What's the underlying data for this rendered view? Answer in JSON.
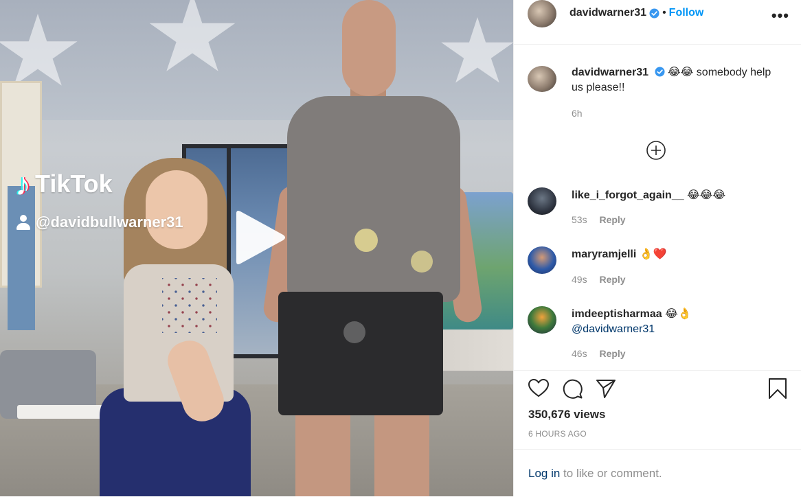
{
  "video": {
    "overlay_brand": "TikTok",
    "overlay_handle": "@davidbullwarner31"
  },
  "post": {
    "author": "davidwarner31",
    "follow_label": "Follow",
    "separator": "•",
    "caption": "😂😂 somebody help us please!!",
    "caption_time": "6h"
  },
  "comments": [
    {
      "user": "like_i_forgot_again__",
      "text": "😂😂😂",
      "time": "53s",
      "reply": "Reply"
    },
    {
      "user": "maryramjelli",
      "text": "👌❤️",
      "time": "49s",
      "reply": "Reply"
    },
    {
      "user": "imdeeptisharmaa",
      "text": "😂👌",
      "mention": "@davidwarner31",
      "time": "46s",
      "reply": "Reply"
    }
  ],
  "stats": {
    "views": "350,676 views",
    "posted": "6 HOURS AGO"
  },
  "footer": {
    "login_link": "Log in",
    "login_rest": " to like or comment."
  },
  "colors": {
    "link_blue": "#0095f6",
    "mention_blue": "#00376b",
    "muted": "#8e8e8e"
  },
  "icons": [
    "verified-badge-icon",
    "more-options-icon",
    "play-icon",
    "load-more-icon",
    "heart-icon",
    "comment-icon",
    "share-icon",
    "bookmark-icon",
    "user-icon"
  ]
}
